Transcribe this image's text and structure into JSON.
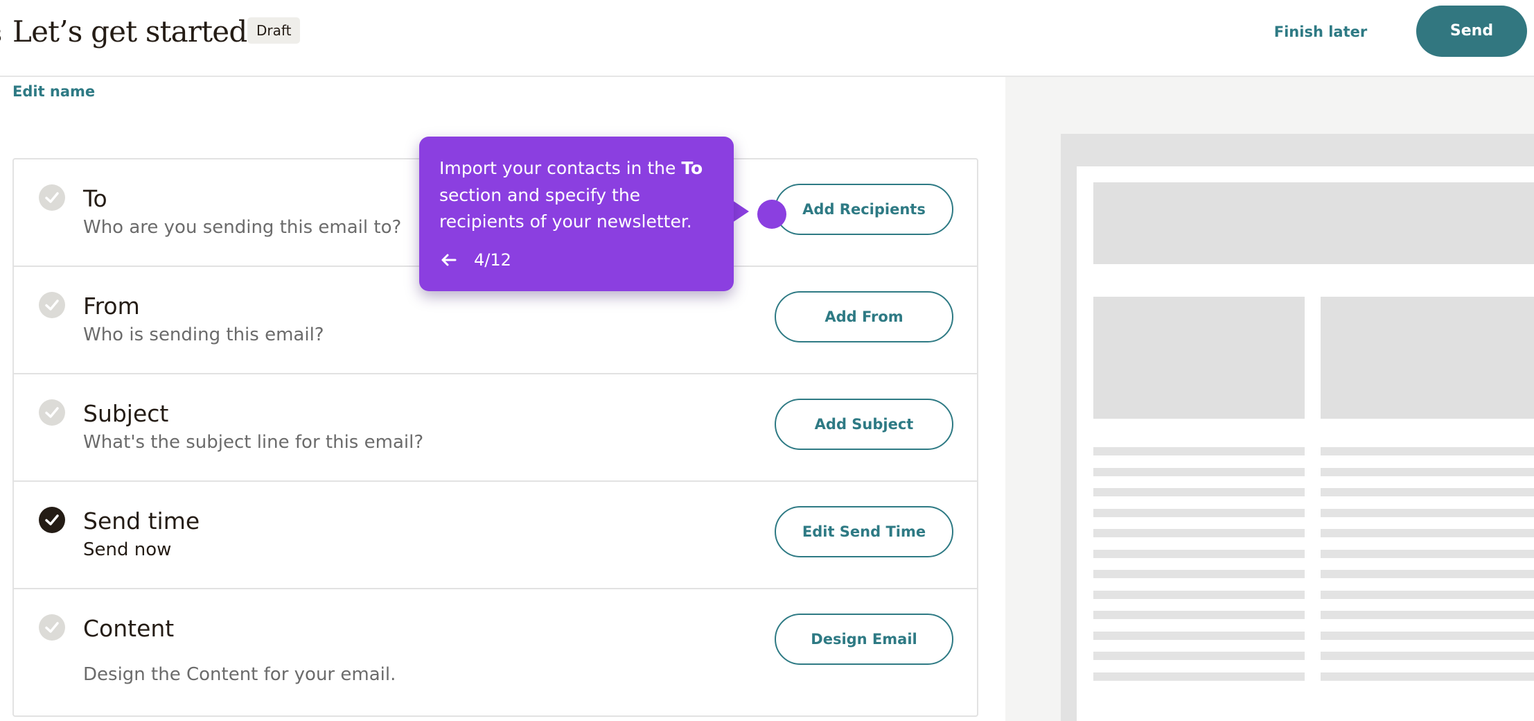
{
  "header": {
    "title": "Let’s get started!",
    "badge": "Draft",
    "finish_later": "Finish later",
    "send": "Send"
  },
  "edit_name": "Edit name",
  "checklist": [
    {
      "title": "To",
      "subtitle": "Who are you sending this email to?",
      "button": "Add Recipients",
      "completed": false
    },
    {
      "title": "From",
      "subtitle": "Who is sending this email?",
      "button": "Add From",
      "completed": false
    },
    {
      "title": "Subject",
      "subtitle": "What's the subject line for this email?",
      "button": "Add Subject",
      "completed": false
    },
    {
      "title": "Send time",
      "subtitle": "Send now",
      "button": "Edit Send Time",
      "completed": true
    },
    {
      "title": "Content",
      "subtitle": "Design the Content for your email.",
      "button": "Design Email",
      "completed": false
    }
  ],
  "tooltip": {
    "text_before": "Import your contacts in the ",
    "text_bold": "To",
    "text_after": " section and specify the recipients of your newsletter.",
    "step": "4/12",
    "back_icon": "arrow-left-icon"
  },
  "colors": {
    "accent": "#2e7a84",
    "send_button": "#327780",
    "tooltip": "#8b3fe0",
    "check_done": "#241c15",
    "check_pending": "#dcdbd7"
  }
}
